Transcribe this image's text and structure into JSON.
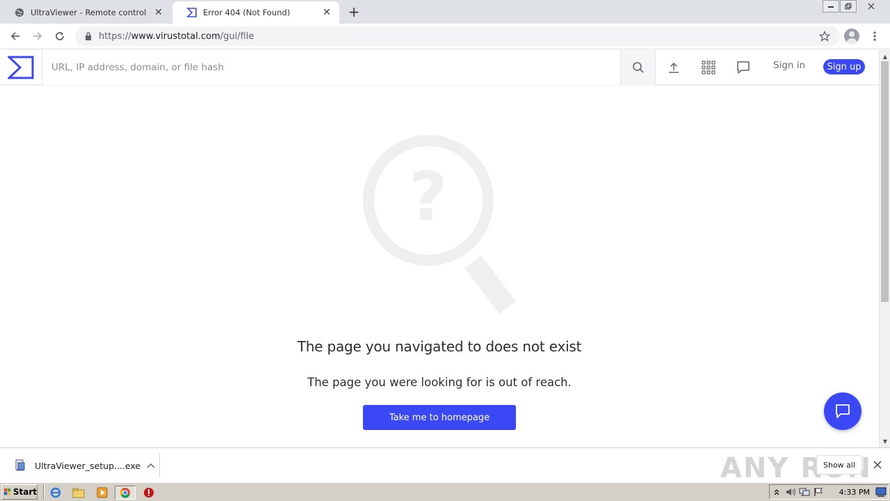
{
  "browser": {
    "tabs": [
      {
        "title": "UltraViewer - Remote control softwa",
        "active": false
      },
      {
        "title": "Error 404 (Not Found)",
        "active": true
      }
    ],
    "new_tab_symbol": "+",
    "close_symbol": "✕",
    "address": {
      "scheme": "https://",
      "host": "www.virustotal.com",
      "path": "/gui/file"
    }
  },
  "site_header": {
    "search_placeholder": "URL, IP address, domain, or file hash",
    "sign_in": "Sign in",
    "sign_up": "Sign up"
  },
  "main": {
    "heading": "The page you navigated to does not exist",
    "subheading": "The page you were looking for is out of reach.",
    "button": "Take me to homepage"
  },
  "download_bar": {
    "file_name": "UltraViewer_setup....exe",
    "show_all": "Show all",
    "watermark": "ANY RUN"
  },
  "taskbar": {
    "start_label": "Start",
    "clock": "4:33 PM"
  },
  "colors": {
    "brand": "#3b48f6",
    "tab_strip": "#dee1e6",
    "illustration": "#efefef"
  }
}
